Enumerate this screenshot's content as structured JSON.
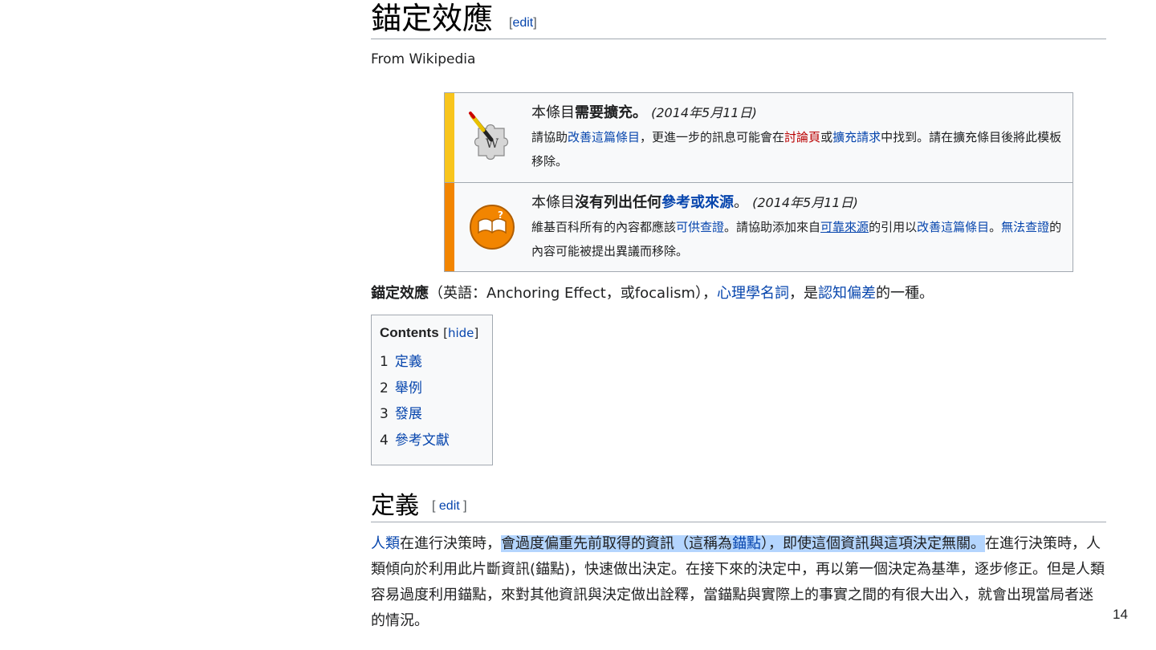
{
  "heading": {
    "title": "錨定效應",
    "edit_open": "[",
    "edit_label": "edit",
    "edit_close": "]"
  },
  "from_line": "From Wikipedia",
  "notices": [
    {
      "bar_color": "#f8c51d",
      "icon": "wikipedia-puzzle-icon",
      "title_prefix": "本條目",
      "title_bold": "需要擴充。",
      "date": "(2014年5月11日)",
      "body": [
        {
          "t": "請協助",
          "type": "text"
        },
        {
          "t": "改善這篇條目",
          "type": "link"
        },
        {
          "t": "，更進一步的訊息可能會在",
          "type": "text"
        },
        {
          "t": "討論頁",
          "type": "redlink"
        },
        {
          "t": "或",
          "type": "text"
        },
        {
          "t": "擴充請求",
          "type": "link"
        },
        {
          "t": "中找到。請在擴充條目後將此模板移除。",
          "type": "text"
        }
      ]
    },
    {
      "bar_color": "#f28500",
      "icon": "book-question-icon",
      "title_prefix": "本條目",
      "title_bold": "沒有列出任何",
      "title_link": "參考或來源",
      "title_suffix": "。",
      "date": "(2014年5月11日)",
      "body": [
        {
          "t": "維基百科所有的內容都應該",
          "type": "text"
        },
        {
          "t": "可供查證",
          "type": "link"
        },
        {
          "t": "。請協助添加來自",
          "type": "text"
        },
        {
          "t": "可靠來源",
          "type": "link"
        },
        {
          "t": "的引用以",
          "type": "text"
        },
        {
          "t": "改善這篇條目",
          "type": "link"
        },
        {
          "t": "。",
          "type": "text"
        },
        {
          "t": "無法查證",
          "type": "link"
        },
        {
          "t": "的內容可能被提出異議而移除。",
          "type": "text"
        }
      ]
    }
  ],
  "lead": {
    "bold": "錨定效應",
    "text1": "（英語：Anchoring Effect，或focalism），",
    "link1": "心理學名詞",
    "text2": "，是",
    "link2": "認知偏差",
    "text3": "的一種。"
  },
  "toc": {
    "title": "Contents",
    "toggle_open": "[",
    "toggle_label": "hide",
    "toggle_close": "]",
    "items": [
      {
        "num": "1",
        "label": "定義"
      },
      {
        "num": "2",
        "label": "舉例"
      },
      {
        "num": "3",
        "label": "發展"
      },
      {
        "num": "4",
        "label": "參考文獻"
      }
    ]
  },
  "section": {
    "title": "定義",
    "edit_open": "[ ",
    "edit_label": "edit",
    "edit_close": " ]"
  },
  "paragraph": {
    "link1": "人類",
    "text1": "在進行決策時，",
    "hl1": "會過度偏重先前取得的資訊（這稱為",
    "hl_link": "錨點",
    "hl2": "），即使這個資訊與這項決定無關。",
    "text2": "在進行決策時，人類傾向於利用此片斷資訊(錨點)，快速做出決定。在接下來的決定中，再以第一個決定為基準，逐步修正。但是人類容易過度利用錨點，來對其他資訊與決定做出詮釋，當錨點與實際上的事實之間的有很大出入，就會出現當局者迷的情況。"
  },
  "page_number": "14"
}
